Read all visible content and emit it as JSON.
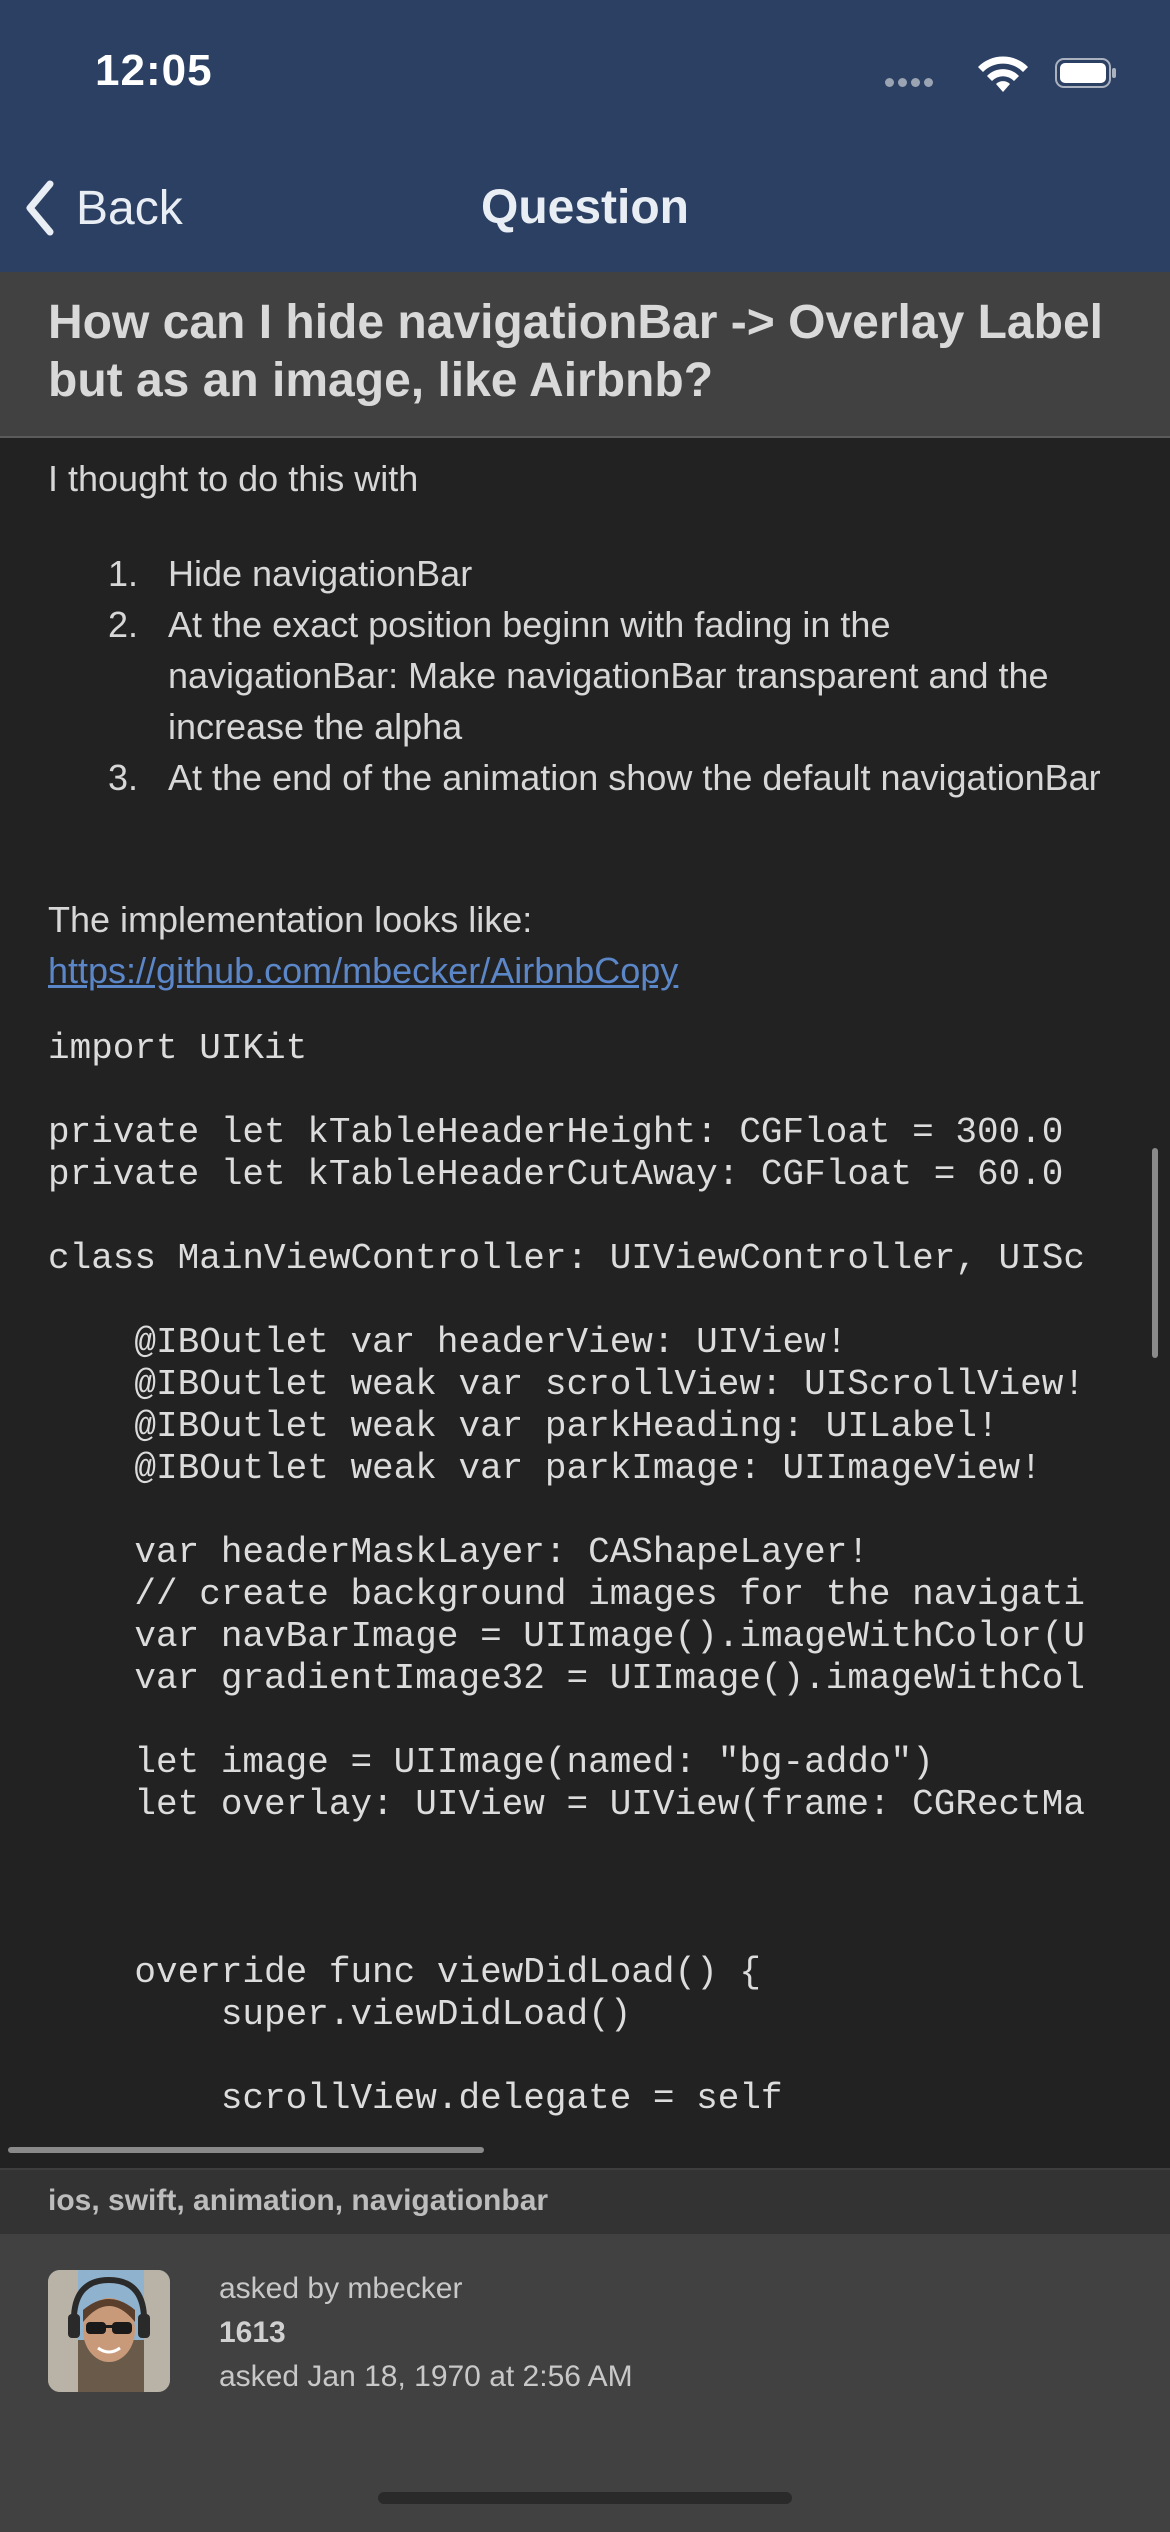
{
  "status_bar": {
    "time": "12:05"
  },
  "nav": {
    "back_label": "Back",
    "title": "Question"
  },
  "question": {
    "title": "How can I hide navigationBar -> Overlay Label but as an image, like Airbnb?",
    "intro": "I thought to do this with",
    "steps": [
      {
        "num": "1.",
        "text": "Hide navigationBar"
      },
      {
        "num": "2.",
        "text": "At the exact position beginn with fading in the navigationBar: Make navigationBar transparent and the increase the alpha"
      },
      {
        "num": "3.",
        "text": "At the end of the animation show the default navigationBar"
      }
    ],
    "implementation_text": "The implementation looks like:",
    "link": "https://github.com/mbecker/AirbnbCopy",
    "code_lines": [
      "import UIKit",
      "",
      "private let kTableHeaderHeight: CGFloat = 300.0",
      "private let kTableHeaderCutAway: CGFloat = 60.0",
      "",
      "class MainViewController: UIViewController, UISc",
      "",
      "    @IBOutlet var headerView: UIView!",
      "    @IBOutlet weak var scrollView: UIScrollView!",
      "    @IBOutlet weak var parkHeading: UILabel!",
      "    @IBOutlet weak var parkImage: UIImageView!",
      "",
      "    var headerMaskLayer: CAShapeLayer!",
      "    // create background images for the navigati",
      "    var navBarImage = UIImage().imageWithColor(U",
      "    var gradientImage32 = UIImage().imageWithCol",
      "",
      "    let image = UIImage(named: \"bg-addo\")",
      "    let overlay: UIView = UIView(frame: CGRectMa",
      "",
      "",
      "",
      "    override func viewDidLoad() {",
      "        super.viewDidLoad()",
      "",
      "        scrollView.delegate = self"
    ],
    "tags": "ios, swift, animation, navigationbar"
  },
  "owner": {
    "asked_by": "asked by mbecker",
    "score": "1613",
    "asked_date": "asked Jan 18, 1970 at 2:56 AM"
  },
  "colors": {
    "nav_bg": "#2b4063",
    "body_bg": "#222222",
    "title_band_bg": "#414141",
    "link": "#5b86c8"
  },
  "icons": [
    "back-chevron-icon",
    "signal-icon",
    "wifi-icon",
    "battery-icon",
    "avatar-photo"
  ]
}
